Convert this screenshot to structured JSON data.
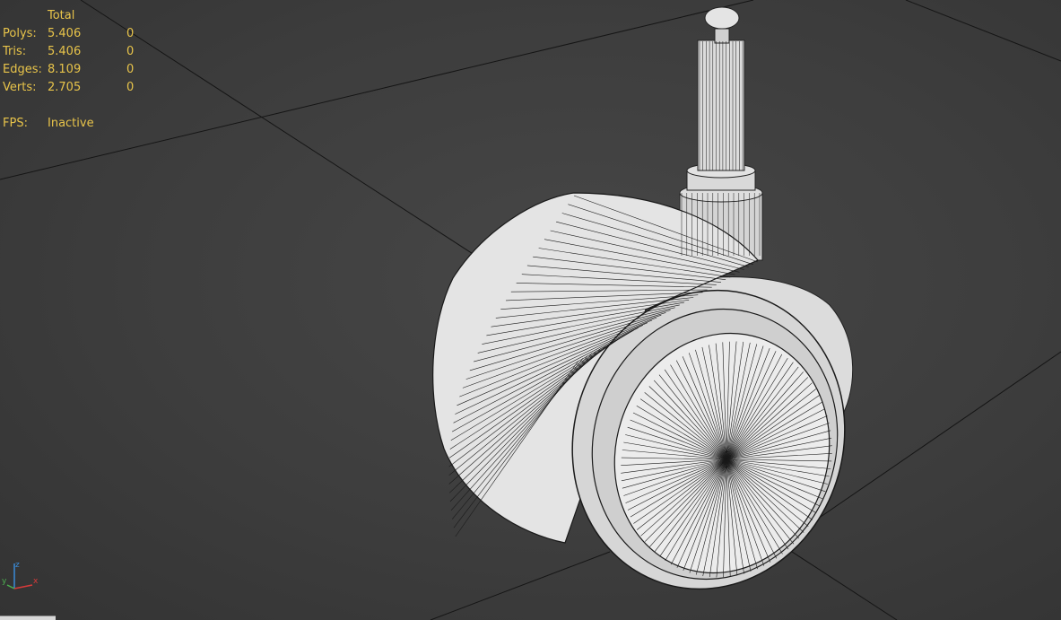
{
  "viewport": {
    "stats": {
      "header": "Total",
      "rows": [
        {
          "label": "Polys:",
          "total": "5.406",
          "selected": "0"
        },
        {
          "label": "Tris:",
          "total": "5.406",
          "selected": "0"
        },
        {
          "label": "Edges:",
          "total": "8.109",
          "selected": "0"
        },
        {
          "label": "Verts:",
          "total": "2.705",
          "selected": "0"
        }
      ],
      "fps_label": "FPS:",
      "fps_value": "Inactive"
    },
    "axis": {
      "z": "z",
      "x": "x",
      "y": "y"
    },
    "colors": {
      "background": "#3d3d3d",
      "stats_text": "#e8c44a",
      "mesh_fill": "#e6e6e6",
      "wire": "#1a1a1a",
      "grid": "#111111"
    }
  }
}
